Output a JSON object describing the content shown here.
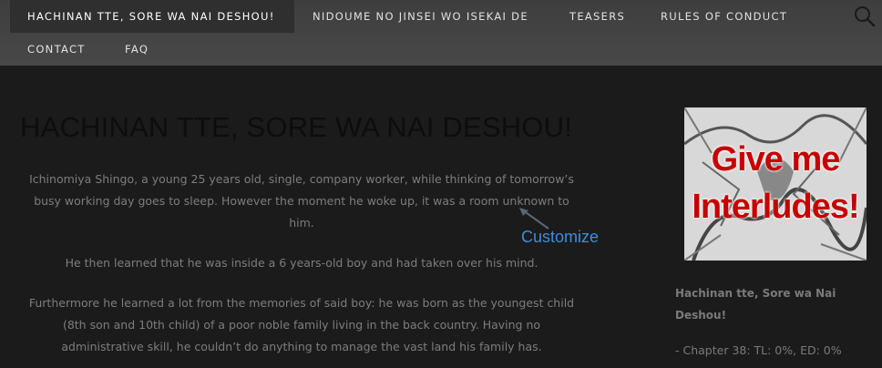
{
  "nav": {
    "items": [
      {
        "label": "HACHINAN TTE, SORE WA NAI DESHOU!"
      },
      {
        "label": "NIDOUME NO JINSEI WO ISEKAI DE"
      },
      {
        "label": "TEASERS"
      },
      {
        "label": "RULES OF CONDUCT"
      },
      {
        "label": "CONTACT"
      },
      {
        "label": "FAQ"
      }
    ],
    "search_icon": "search-icon"
  },
  "page": {
    "title": "HACHINAN TTE, SORE WA NAI DESHOU!",
    "paragraphs": [
      "Ichinomiya Shingo, a young 25 years old, single, company worker, while thinking of tomorrow’s busy working day goes to sleep. However the moment he woke up, it was a room unknown to him.",
      "He then learned that he was inside a 6 years-old boy and had taken over his mind.",
      "Furthermore he learned a lot from the memories of said boy: he was born as the youngest child (8th son and 10th child) of a poor noble family living in the back country. Having no administrative skill, he couldn’t do anything to manage the vast land his family has."
    ],
    "customize_label": "Customize"
  },
  "sidebar": {
    "image_text_line1": "Give me",
    "image_text_line2": "Interludes!",
    "widget_title": "Hachinan tte, Sore wa Nai Deshou!",
    "chapter_line": "- Chapter 38: TL: 0%, ED: 0%"
  },
  "colors": {
    "nav_bg": "#434343",
    "page_bg": "#1b1b1b",
    "accent_red": "#c60000",
    "customize_blue": "#3f8ddb"
  }
}
